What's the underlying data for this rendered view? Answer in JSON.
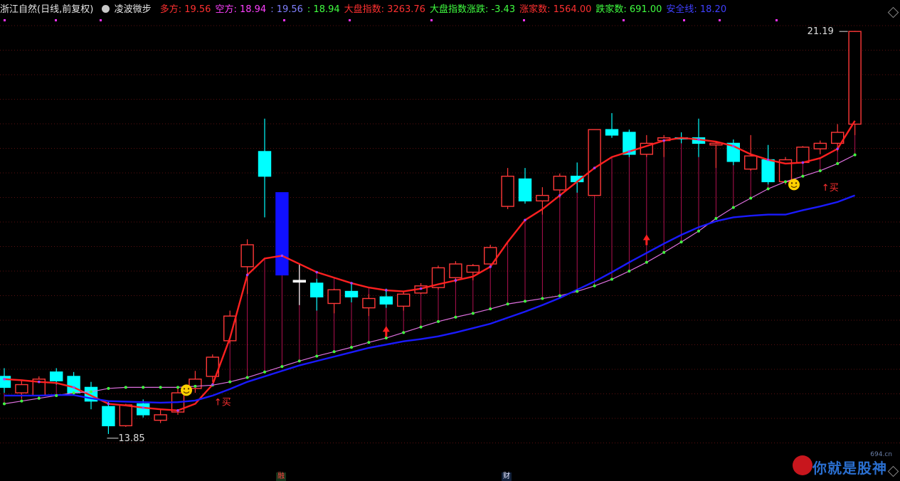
{
  "header": {
    "title": "浙江自然(日线,前复权)",
    "indicator_name": "凌波微步",
    "items": [
      {
        "label": "多方:",
        "value": "19.56",
        "color": "#ff3030"
      },
      {
        "label": "空方:",
        "value": "18.94",
        "color": "#ff40ff"
      },
      {
        "label": ":",
        "value": "19.56",
        "color": "#8080ff",
        "prefix_only": true
      },
      {
        "label": ":",
        "value": "18.94",
        "color": "#40ff40",
        "prefix_only": true
      },
      {
        "label": "大盘指数:",
        "value": "3263.76",
        "color": "#ff3030"
      },
      {
        "label": "大盘指数涨跌:",
        "value": "-3.43",
        "color": "#40ff40"
      },
      {
        "label": "涨家数:",
        "value": "1564.00",
        "color": "#ff3030"
      },
      {
        "label": "跌家数:",
        "value": "691.00",
        "color": "#40ff40"
      },
      {
        "label": "安全线:",
        "value": "18.20",
        "color": "#4040ff"
      }
    ]
  },
  "chart_data": {
    "type": "candlestick",
    "ylim": [
      13.2,
      21.4
    ],
    "high_label": "21.19",
    "low_label": "13.85",
    "buy_label": "↑买",
    "candles": [
      {
        "o": 14.9,
        "h": 15.05,
        "l": 14.6,
        "c": 14.7,
        "color": "cyan"
      },
      {
        "o": 14.6,
        "h": 14.82,
        "l": 14.5,
        "c": 14.75,
        "color": "red"
      },
      {
        "o": 14.55,
        "h": 14.9,
        "l": 14.5,
        "c": 14.85,
        "color": "red"
      },
      {
        "o": 14.98,
        "h": 15.05,
        "l": 14.75,
        "c": 14.82,
        "color": "cyan"
      },
      {
        "o": 14.9,
        "h": 14.98,
        "l": 14.55,
        "c": 14.6,
        "color": "cyan"
      },
      {
        "o": 14.7,
        "h": 14.8,
        "l": 14.3,
        "c": 14.45,
        "color": "cyan"
      },
      {
        "o": 14.35,
        "h": 14.45,
        "l": 13.85,
        "c": 14.0,
        "color": "cyan"
      },
      {
        "o": 14.0,
        "h": 14.4,
        "l": 13.98,
        "c": 14.38,
        "color": "red"
      },
      {
        "o": 14.4,
        "h": 14.48,
        "l": 14.15,
        "c": 14.2,
        "color": "cyan"
      },
      {
        "o": 14.1,
        "h": 14.3,
        "l": 14.05,
        "c": 14.2,
        "color": "red"
      },
      {
        "o": 14.25,
        "h": 14.7,
        "l": 14.2,
        "c": 14.6,
        "color": "red"
      },
      {
        "o": 14.68,
        "h": 15.0,
        "l": 14.6,
        "c": 14.85,
        "color": "red"
      },
      {
        "o": 14.9,
        "h": 15.3,
        "l": 14.8,
        "c": 15.25,
        "color": "red"
      },
      {
        "o": 15.55,
        "h": 16.1,
        "l": 15.5,
        "c": 16.0,
        "color": "red"
      },
      {
        "o": 16.9,
        "h": 17.4,
        "l": 16.4,
        "c": 17.3,
        "color": "red"
      },
      {
        "o": 19.0,
        "h": 19.6,
        "l": 17.8,
        "c": 18.55,
        "color": "cyan"
      },
      {
        "o": 18.25,
        "h": 18.25,
        "l": 16.75,
        "c": 16.75,
        "color": "blue"
      },
      {
        "o": 16.65,
        "h": 16.95,
        "l": 16.2,
        "c": 16.62,
        "color": "white"
      },
      {
        "o": 16.6,
        "h": 16.68,
        "l": 16.1,
        "c": 16.35,
        "color": "cyan"
      },
      {
        "o": 16.23,
        "h": 16.5,
        "l": 16.05,
        "c": 16.48,
        "color": "red"
      },
      {
        "o": 16.45,
        "h": 16.58,
        "l": 16.25,
        "c": 16.35,
        "color": "cyan"
      },
      {
        "o": 16.15,
        "h": 16.4,
        "l": 16.0,
        "c": 16.32,
        "color": "red"
      },
      {
        "o": 16.35,
        "h": 16.5,
        "l": 16.15,
        "c": 16.22,
        "color": "cyan"
      },
      {
        "o": 16.18,
        "h": 16.45,
        "l": 16.1,
        "c": 16.4,
        "color": "red"
      },
      {
        "o": 16.42,
        "h": 16.6,
        "l": 16.4,
        "c": 16.55,
        "color": "red"
      },
      {
        "o": 16.52,
        "h": 16.92,
        "l": 16.48,
        "c": 16.88,
        "color": "red"
      },
      {
        "o": 16.7,
        "h": 17.0,
        "l": 16.6,
        "c": 16.95,
        "color": "red"
      },
      {
        "o": 16.8,
        "h": 16.95,
        "l": 16.65,
        "c": 16.92,
        "color": "red"
      },
      {
        "o": 16.95,
        "h": 17.3,
        "l": 16.9,
        "c": 17.25,
        "color": "red"
      },
      {
        "o": 18.0,
        "h": 18.7,
        "l": 17.95,
        "c": 18.55,
        "color": "red"
      },
      {
        "o": 18.5,
        "h": 18.7,
        "l": 18.05,
        "c": 18.1,
        "color": "cyan"
      },
      {
        "o": 18.1,
        "h": 18.35,
        "l": 17.85,
        "c": 18.2,
        "color": "red"
      },
      {
        "o": 18.3,
        "h": 18.6,
        "l": 18.15,
        "c": 18.55,
        "color": "red"
      },
      {
        "o": 18.55,
        "h": 18.8,
        "l": 18.25,
        "c": 18.45,
        "color": "cyan"
      },
      {
        "o": 18.2,
        "h": 19.4,
        "l": 18.2,
        "c": 19.4,
        "color": "red"
      },
      {
        "o": 19.4,
        "h": 19.7,
        "l": 19.25,
        "c": 19.3,
        "color": "cyan"
      },
      {
        "o": 19.35,
        "h": 19.4,
        "l": 18.9,
        "c": 18.95,
        "color": "cyan"
      },
      {
        "o": 18.95,
        "h": 19.3,
        "l": 18.9,
        "c": 19.15,
        "color": "red"
      },
      {
        "o": 19.2,
        "h": 19.3,
        "l": 18.9,
        "c": 19.25,
        "color": "red"
      },
      {
        "o": 19.25,
        "h": 19.35,
        "l": 19.15,
        "c": 19.25,
        "color": "cyan"
      },
      {
        "o": 19.25,
        "h": 19.6,
        "l": 18.9,
        "c": 19.15,
        "color": "cyan"
      },
      {
        "o": 19.12,
        "h": 19.18,
        "l": 18.7,
        "c": 19.15,
        "color": "red"
      },
      {
        "o": 19.15,
        "h": 19.22,
        "l": 18.75,
        "c": 18.82,
        "color": "cyan"
      },
      {
        "o": 18.68,
        "h": 19.3,
        "l": 18.65,
        "c": 18.92,
        "color": "red"
      },
      {
        "o": 18.85,
        "h": 19.12,
        "l": 18.4,
        "c": 18.45,
        "color": "cyan"
      },
      {
        "o": 18.45,
        "h": 18.9,
        "l": 18.4,
        "c": 18.85,
        "color": "red"
      },
      {
        "o": 18.8,
        "h": 19.1,
        "l": 18.78,
        "c": 19.08,
        "color": "red"
      },
      {
        "o": 19.05,
        "h": 19.2,
        "l": 18.95,
        "c": 19.15,
        "color": "red"
      },
      {
        "o": 19.15,
        "h": 19.5,
        "l": 19.0,
        "c": 19.35,
        "color": "red"
      },
      {
        "o": 19.5,
        "h": 21.2,
        "l": 19.3,
        "c": 21.19,
        "color": "red"
      }
    ],
    "series": [
      {
        "name": "多方",
        "color": "#ff2020",
        "values": [
          14.85,
          14.83,
          14.8,
          14.78,
          14.7,
          14.55,
          14.4,
          14.37,
          14.33,
          14.3,
          14.28,
          14.4,
          14.75,
          15.6,
          16.75,
          17.05,
          17.1,
          16.95,
          16.8,
          16.7,
          16.6,
          16.52,
          16.47,
          16.45,
          16.5,
          16.58,
          16.65,
          16.72,
          16.9,
          17.35,
          17.75,
          17.95,
          18.2,
          18.45,
          18.7,
          18.9,
          19.0,
          19.1,
          19.2,
          19.25,
          19.22,
          19.18,
          19.1,
          18.95,
          18.85,
          18.78,
          18.8,
          18.88,
          19.05,
          19.56
        ]
      },
      {
        "name": "空方",
        "color": "#e070e0",
        "values": [
          14.4,
          14.45,
          14.5,
          14.55,
          14.6,
          14.62,
          14.68,
          14.7,
          14.7,
          14.7,
          14.7,
          14.72,
          14.74,
          14.8,
          14.88,
          14.98,
          15.08,
          15.18,
          15.27,
          15.35,
          15.43,
          15.52,
          15.6,
          15.7,
          15.8,
          15.9,
          15.98,
          16.05,
          16.13,
          16.22,
          16.27,
          16.32,
          16.37,
          16.45,
          16.55,
          16.67,
          16.82,
          16.98,
          17.16,
          17.35,
          17.55,
          17.78,
          17.98,
          18.15,
          18.32,
          18.45,
          18.55,
          18.65,
          18.78,
          18.94
        ]
      },
      {
        "name": "安全线",
        "color": "#1a1aff",
        "values": [
          14.55,
          14.55,
          14.55,
          14.56,
          14.56,
          14.5,
          14.45,
          14.44,
          14.43,
          14.42,
          14.43,
          14.46,
          14.55,
          14.67,
          14.8,
          14.9,
          15.0,
          15.1,
          15.18,
          15.26,
          15.34,
          15.42,
          15.48,
          15.54,
          15.58,
          15.63,
          15.7,
          15.78,
          15.86,
          15.97,
          16.08,
          16.2,
          16.33,
          16.48,
          16.63,
          16.8,
          16.98,
          17.15,
          17.32,
          17.48,
          17.62,
          17.73,
          17.8,
          17.83,
          17.85,
          17.85,
          17.93,
          18.0,
          18.08,
          18.2
        ]
      }
    ],
    "buy_arrows": [
      22,
      37
    ],
    "buy_text_at": [
      12,
      47
    ],
    "smile_at": [
      10,
      45
    ]
  },
  "footer": {
    "marks": [
      {
        "text": "融",
        "color": "#ff4040",
        "bg": "#14331a"
      },
      {
        "text": "财",
        "color": "#e8e8ff",
        "bg": "#10203a"
      }
    ],
    "watermark_site": "694.cn",
    "watermark_text": "你就是股神"
  }
}
